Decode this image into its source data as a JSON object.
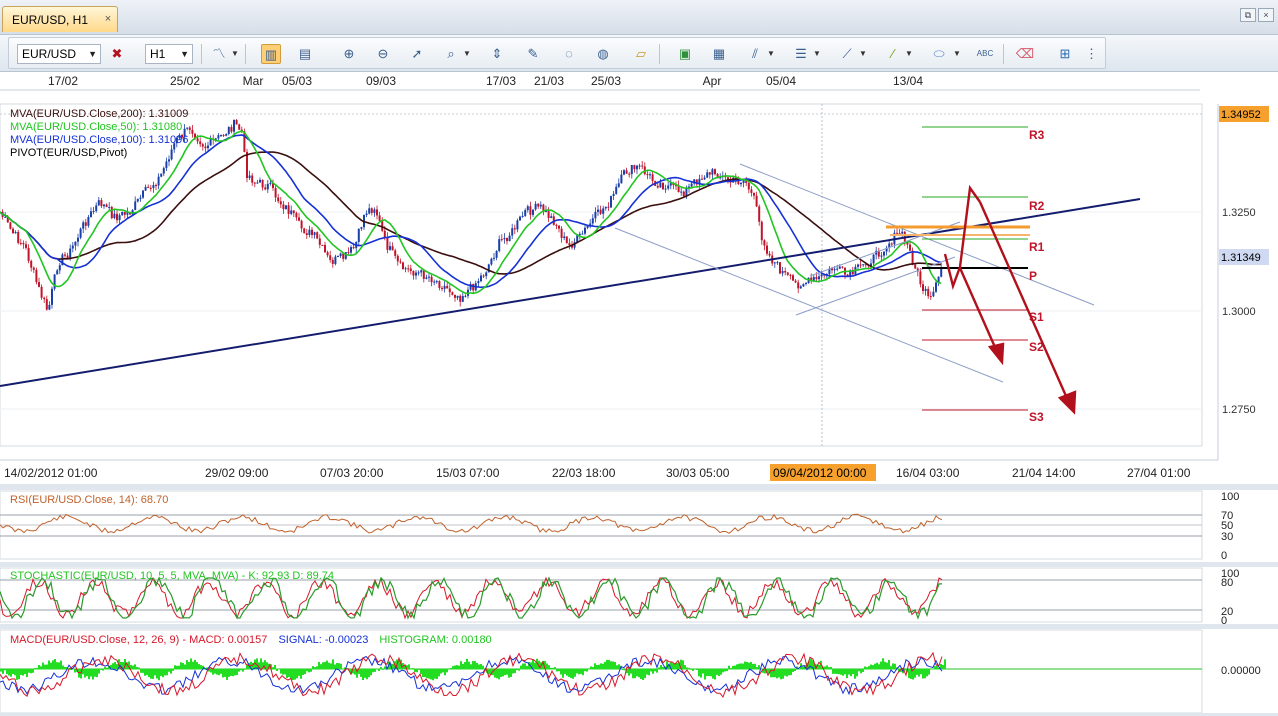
{
  "tab": {
    "title": "EUR/USD, H1",
    "close": "×"
  },
  "window": {
    "restore": "⧉",
    "close": "×"
  },
  "toolbar": {
    "symbol": "EUR/USD",
    "timeframe": "H1",
    "icons": [
      "symbol-remove-icon",
      "chart-type-icon",
      "bar-chart-icon",
      "table-icon",
      "zoom-in-icon",
      "zoom-out-icon",
      "cursor-icon",
      "period-icon",
      "fit-icon",
      "edit-icon",
      "hide-icon",
      "globe-icon",
      "ruler-icon",
      "picture-icon",
      "template-icon",
      "trend-tools-icon",
      "lines-icon",
      "fan-icon",
      "pen-icon",
      "ellipse-icon",
      "text-icon",
      "eraser-icon",
      "tree-icon",
      "more-icon"
    ]
  },
  "top_axis": {
    "labels": [
      "17/02",
      "25/02",
      "Mar",
      "05/03",
      "09/03",
      "17/03",
      "21/03",
      "25/03",
      "Apr",
      "05/04",
      "13/04"
    ]
  },
  "main_legend": [
    {
      "text": "MVA(EUR/USD.Close,200): 1.31009",
      "color": "#3b0f0f"
    },
    {
      "text": "MVA(EUR/USD.Close,50): 1.31080",
      "color": "#22c522"
    },
    {
      "text": "MVA(EUR/USD.Close,100): 1.31096",
      "color": "#1531d6"
    },
    {
      "text": "PIVOT(EUR/USD,Pivot)",
      "color": "#000000"
    }
  ],
  "price_axis": {
    "ticks": [
      "1.3250",
      "1.3000",
      "1.2750"
    ],
    "top_price": "1.34952",
    "current_price": "1.31349"
  },
  "pivot_levels": [
    "R3",
    "R2",
    "R1",
    "P",
    "S1",
    "S2",
    "S3"
  ],
  "time_axis": {
    "labels": [
      "14/02/2012 01:00",
      "29/02 09:00",
      "07/03 20:00",
      "15/03 07:00",
      "22/03 18:00",
      "30/03 05:00",
      "16/04 03:00",
      "21/04 14:00",
      "27/04 01:00"
    ],
    "cursor_label": "09/04/2012 00:00"
  },
  "rsi": {
    "label": "RSI(EUR/USD.Close, 14): 68.70",
    "ticks": [
      "100",
      "70",
      "50",
      "30",
      "0"
    ]
  },
  "stochastic": {
    "label": "STOCHASTIC(EUR/USD, 10, 5, 5, MVA, MVA)  -  K: 92.93   D: 89.74",
    "ticks": [
      "100",
      "80",
      "20",
      "0"
    ]
  },
  "macd": {
    "label_main": "MACD(EUR/USD.Close, 12, 26, 9)  -  MACD: 0.00157",
    "label_signal": "SIGNAL: -0.00023",
    "label_hist": "HISTOGRAM: 0.00180",
    "ticks": [
      "0.00000"
    ]
  },
  "colors": {
    "up": "#1a3fa8",
    "down": "#c0142a",
    "ma200": "#3b0f0f",
    "ma50": "#22c522",
    "ma100": "#1531d6",
    "orange": "#f59a2e"
  }
}
